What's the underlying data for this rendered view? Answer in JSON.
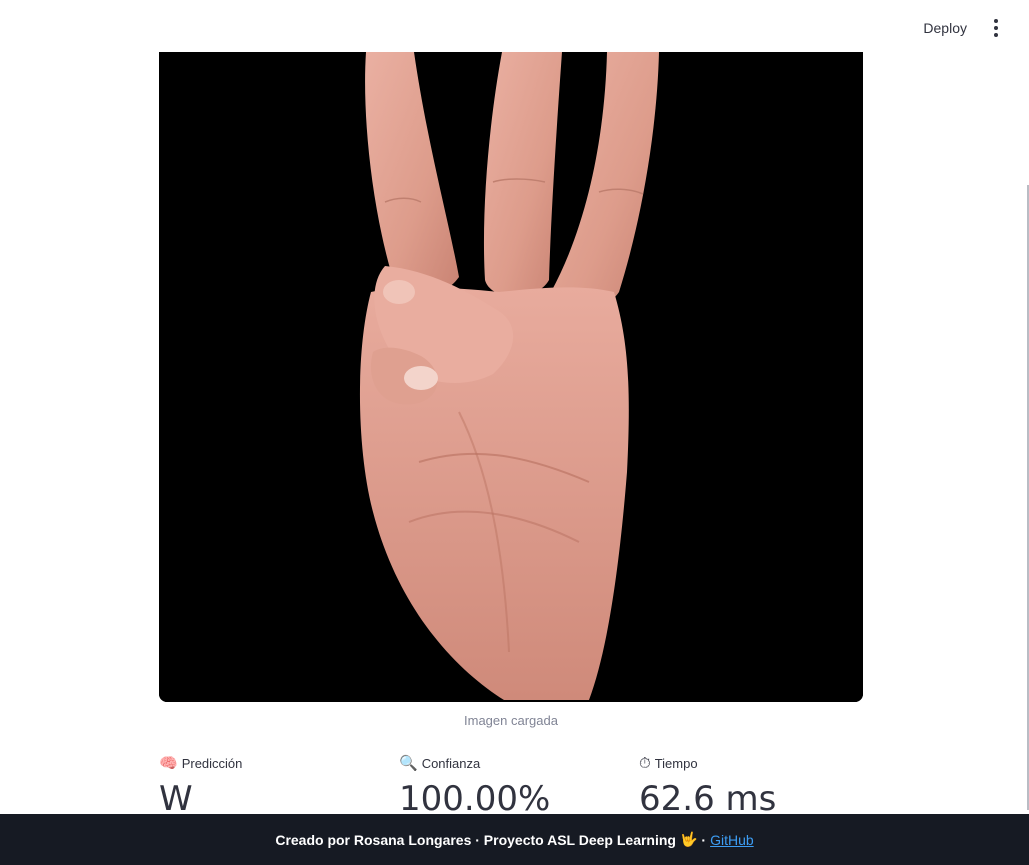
{
  "header": {
    "deploy_label": "Deploy",
    "menu_icon": "vertical-ellipsis-icon"
  },
  "image": {
    "caption": "Imagen cargada"
  },
  "metrics": [
    {
      "emoji": "🧠",
      "label": "Predicción",
      "value": "W"
    },
    {
      "emoji": "🔍",
      "label": "Confianza",
      "value": "100.00%"
    },
    {
      "emoji": "⏱",
      "label": "Tiempo",
      "value": "62.6 ms"
    }
  ],
  "footer": {
    "text": "Creado por Rosana Longares · Proyecto ASL Deep Learning",
    "emoji": "🤟",
    "separator": "·",
    "link_label": "GitHub"
  },
  "colors": {
    "footer_bg": "#161a23",
    "link": "#3d9df3",
    "image_bg": "#000000",
    "skin": "#e3a392"
  }
}
